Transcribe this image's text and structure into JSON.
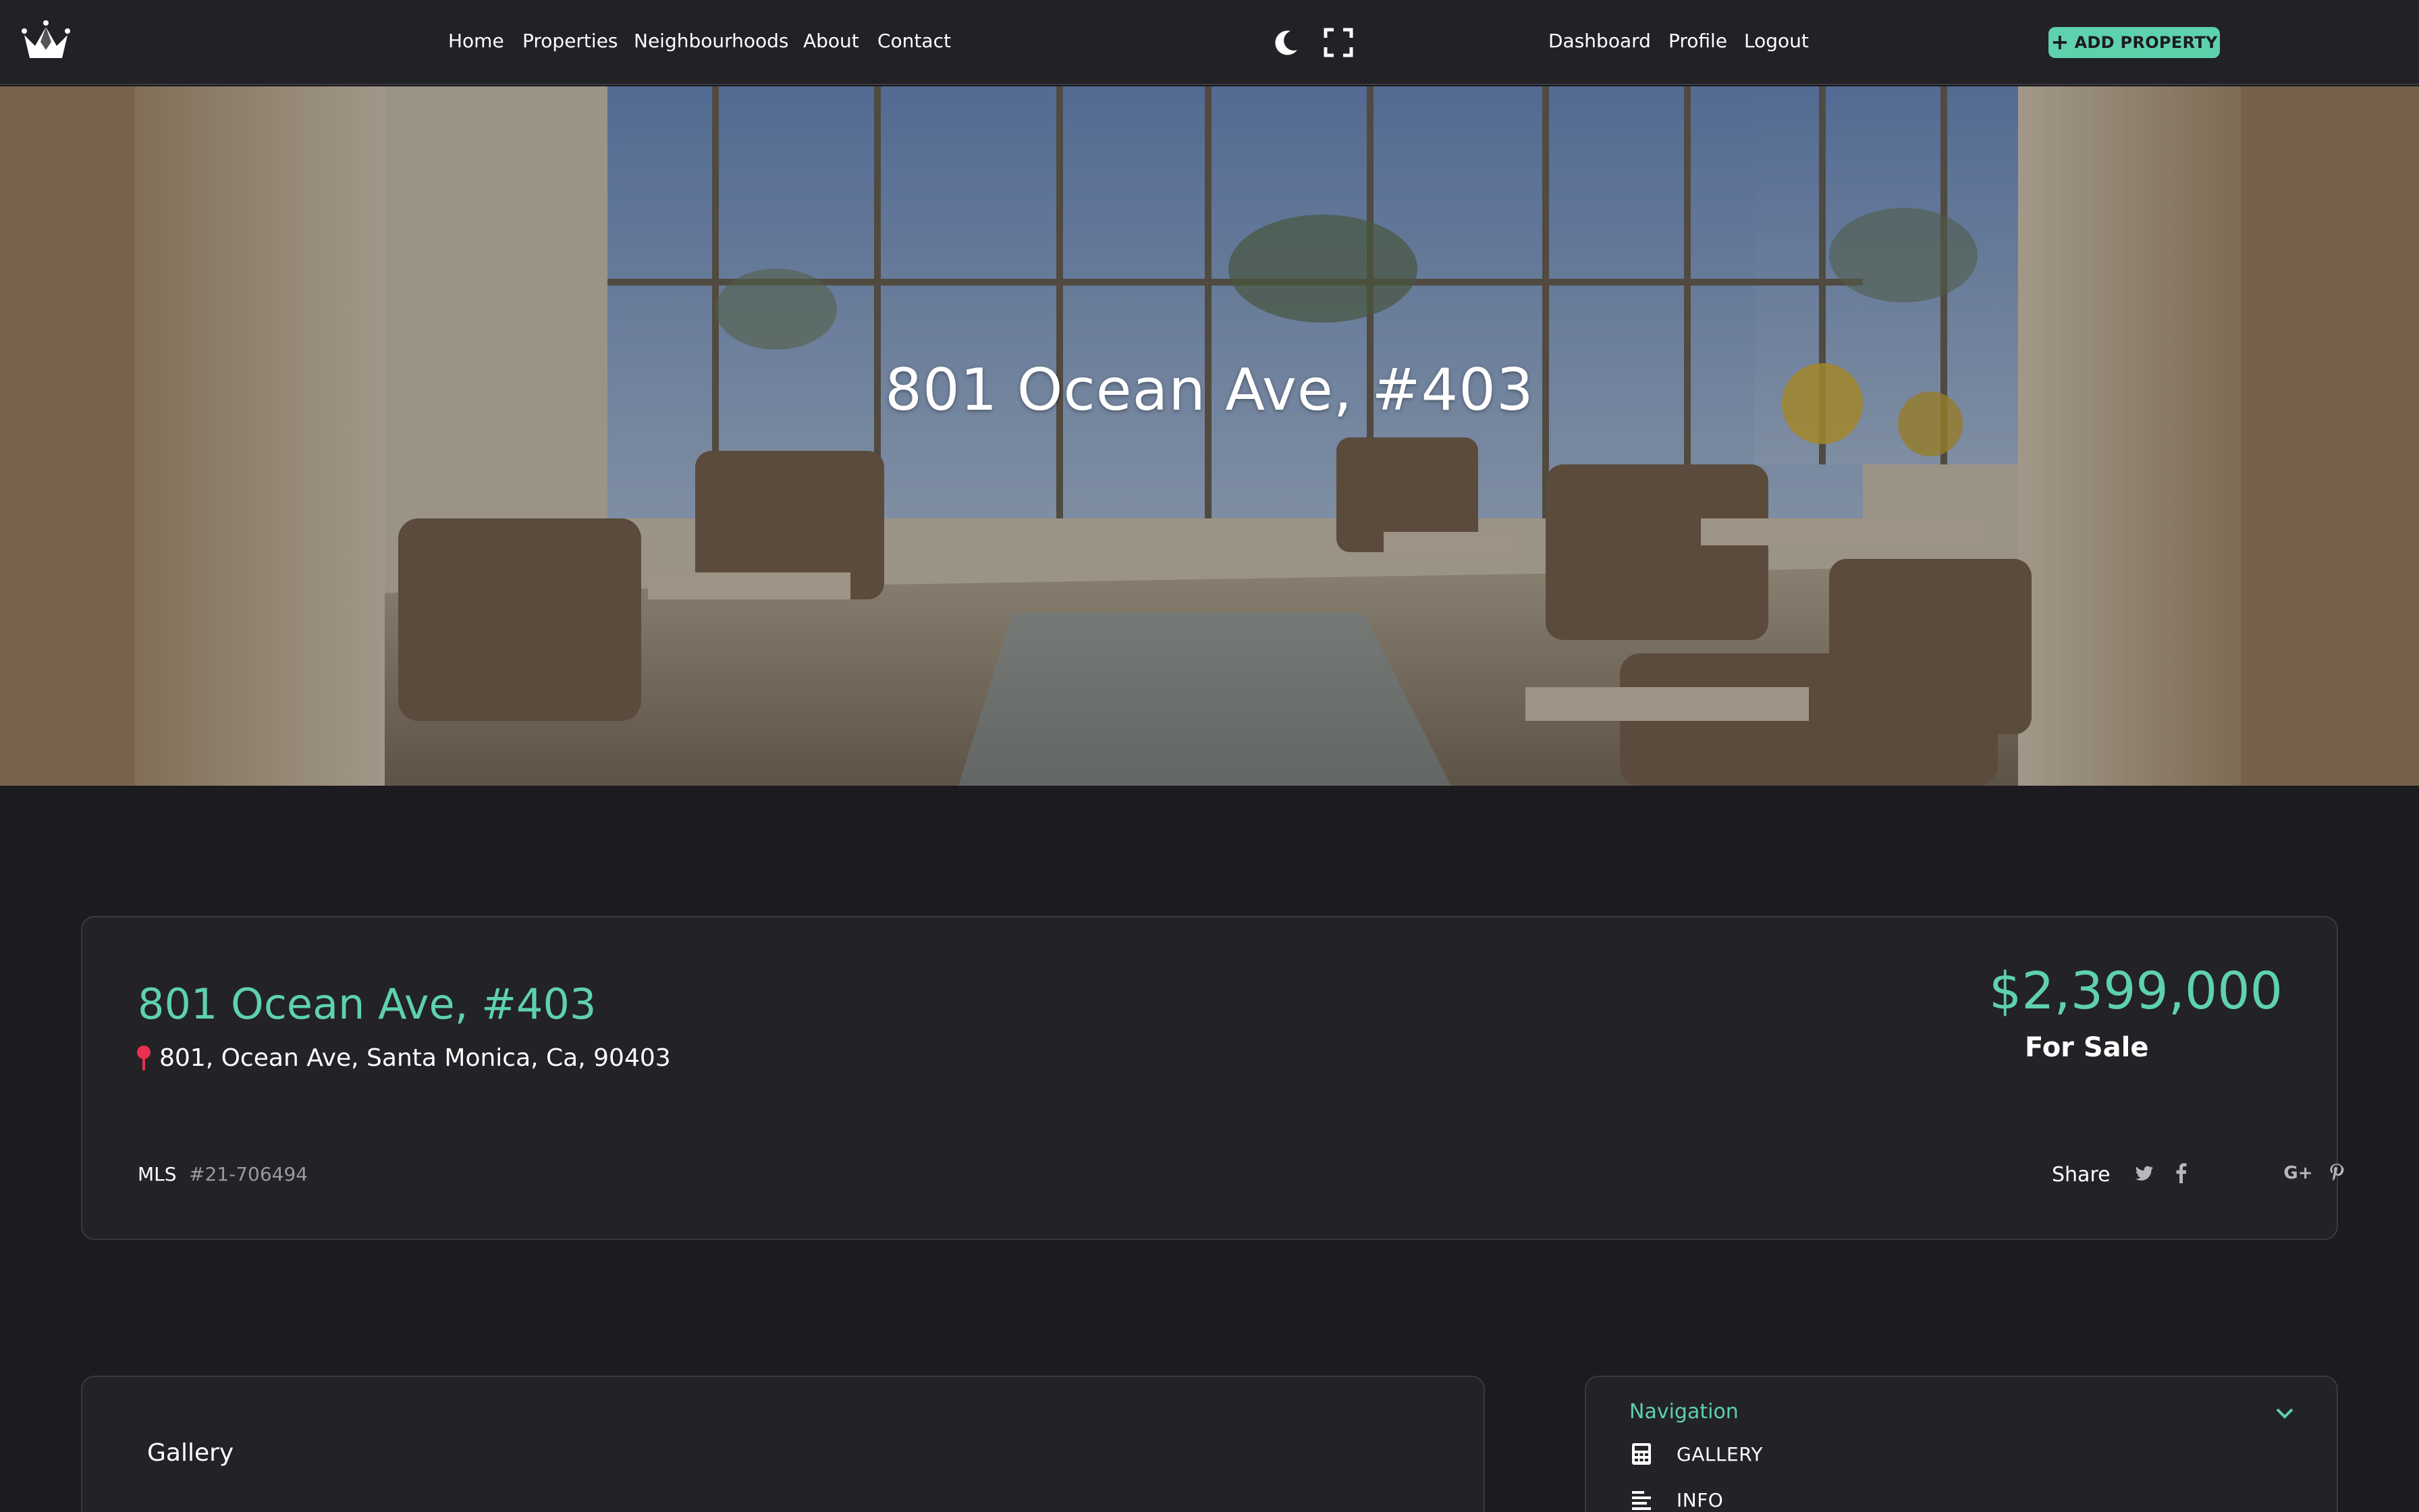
{
  "navbar": {
    "logo_icon": "crown-icon",
    "links": [
      "Home",
      "Properties",
      "Neighbourhoods",
      "About",
      "Contact"
    ],
    "dark_mode_icon": "moon-icon",
    "fullscreen_icon": "fullscreen-icon",
    "user_links": [
      "Dashboard",
      "Profile",
      "Logout"
    ],
    "add_property": "ADD PROPERTY"
  },
  "hero": {
    "title": "801 Ocean Ave, #403"
  },
  "listing": {
    "title": "801 Ocean Ave, #403",
    "address": "801, Ocean Ave, Santa Monica, Ca, 90403",
    "price": "$2,399,000",
    "status": "For Sale",
    "mls_label": "MLS",
    "mls_value": "#21-706494",
    "share_label": "Share",
    "share_icons": [
      "twitter-icon",
      "facebook-icon",
      "google-plus-icon",
      "pinterest-icon"
    ]
  },
  "gallery": {
    "title": "Gallery"
  },
  "side_nav": {
    "title": "Navigation",
    "items": [
      {
        "label": "GALLERY",
        "icon": "calculator-icon"
      },
      {
        "label": "INFO",
        "icon": "align-left-icon"
      }
    ]
  },
  "colors": {
    "accent": "#5ed1ad",
    "background": "#1c1b1f",
    "card": "#232227",
    "pin": "#e8304f"
  }
}
